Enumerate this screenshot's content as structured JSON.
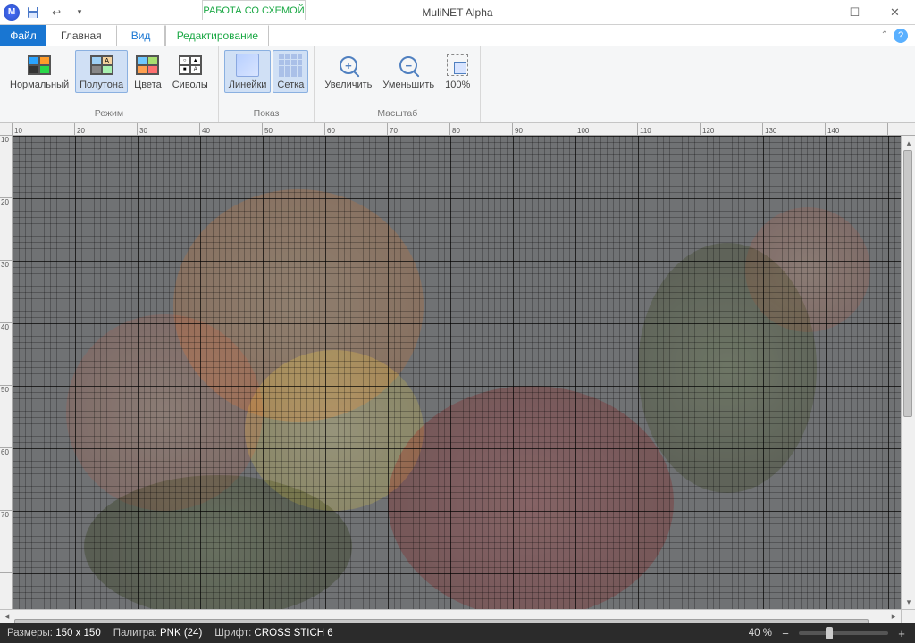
{
  "titlebar": {
    "app_initial": "M",
    "title": "MuliNET Alpha",
    "context_group": "РАБОТА СО СХЕМОЙ"
  },
  "tabs": {
    "file": "Файл",
    "items": [
      "Главная",
      "Вид"
    ],
    "context": "Редактирование",
    "active": "Вид"
  },
  "ribbon": {
    "groups": [
      {
        "label": "Режим",
        "buttons": [
          {
            "name": "mode-normal",
            "label": "Нормальный"
          },
          {
            "name": "mode-halftone",
            "label": "Полутона",
            "active": true
          },
          {
            "name": "mode-colors",
            "label": "Цвета"
          },
          {
            "name": "mode-symbols",
            "label": "Сиволы"
          }
        ]
      },
      {
        "label": "Показ",
        "buttons": [
          {
            "name": "show-rulers",
            "label": "Линейки",
            "active": true
          },
          {
            "name": "show-grid",
            "label": "Сетка",
            "active": true
          }
        ]
      },
      {
        "label": "Масштаб",
        "buttons": [
          {
            "name": "zoom-in",
            "label": "Увеличить"
          },
          {
            "name": "zoom-out",
            "label": "Уменьшить"
          },
          {
            "name": "zoom-100",
            "label": "100%"
          }
        ]
      }
    ]
  },
  "ruler": {
    "h": [
      "10",
      "20",
      "30",
      "40",
      "50",
      "60",
      "70",
      "80",
      "90",
      "100",
      "110",
      "120",
      "130",
      "140"
    ],
    "v": [
      "10",
      "20",
      "30",
      "40",
      "50",
      "60",
      "70"
    ]
  },
  "statusbar": {
    "size_label": "Размеры:",
    "size_value": "150 x 150",
    "palette_label": "Палитра:",
    "palette_value": "PNK (24)",
    "font_label": "Шрифт:",
    "font_value": "CROSS STICH 6",
    "zoom_text": "40 %"
  }
}
